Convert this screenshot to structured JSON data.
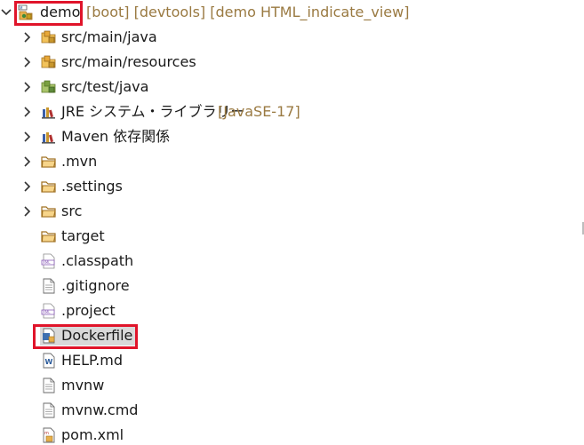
{
  "tree": {
    "root": {
      "label": "demo",
      "decoration": "[boot] [devtools] [demo HTML_indicate_view]",
      "icon": "spring-project-icon",
      "expanded": true
    },
    "items": [
      {
        "label": "src/main/java",
        "decoration": "",
        "icon": "java-source-folder-icon",
        "expandable": true
      },
      {
        "label": "src/main/resources",
        "decoration": "",
        "icon": "java-source-folder-icon",
        "expandable": true
      },
      {
        "label": "src/test/java",
        "decoration": "",
        "icon": "java-test-source-folder-icon",
        "expandable": true
      },
      {
        "label": "JRE システム・ライブラリー",
        "decoration": "[JavaSE-17]",
        "icon": "library-icon",
        "expandable": true
      },
      {
        "label": "Maven 依存関係",
        "decoration": "",
        "icon": "library-icon",
        "expandable": true
      },
      {
        "label": ".mvn",
        "decoration": "",
        "icon": "folder-icon",
        "expandable": true
      },
      {
        "label": ".settings",
        "decoration": "",
        "icon": "folder-icon",
        "expandable": true
      },
      {
        "label": "src",
        "decoration": "",
        "icon": "folder-icon",
        "expandable": true
      },
      {
        "label": "target",
        "decoration": "",
        "icon": "folder-icon",
        "expandable": false
      },
      {
        "label": ".classpath",
        "decoration": "",
        "icon": "xml-file-icon",
        "expandable": false
      },
      {
        "label": ".gitignore",
        "decoration": "",
        "icon": "text-file-icon",
        "expandable": false
      },
      {
        "label": ".project",
        "decoration": "",
        "icon": "xml-file-icon",
        "expandable": false
      },
      {
        "label": "Dockerfile",
        "decoration": "",
        "icon": "dockerfile-icon",
        "expandable": false,
        "selected": true
      },
      {
        "label": "HELP.md",
        "decoration": "",
        "icon": "markdown-file-icon",
        "expandable": false
      },
      {
        "label": "mvnw",
        "decoration": "",
        "icon": "text-file-icon",
        "expandable": false
      },
      {
        "label": "mvnw.cmd",
        "decoration": "",
        "icon": "text-file-icon",
        "expandable": false
      },
      {
        "label": "pom.xml",
        "decoration": "",
        "icon": "maven-pom-icon",
        "expandable": false
      }
    ]
  },
  "colors": {
    "highlight": "#e0142a",
    "decoration": "#9a7a42",
    "selection": "#d9d9d9",
    "folder": "#e8b04a",
    "java_package": "#c8962c",
    "test_package": "#5e8a3a",
    "library": "#3b5ea8",
    "file_outline": "#6a6a6a",
    "xml_purple": "#8a5cb8",
    "docker_blue": "#3d6fb0"
  }
}
